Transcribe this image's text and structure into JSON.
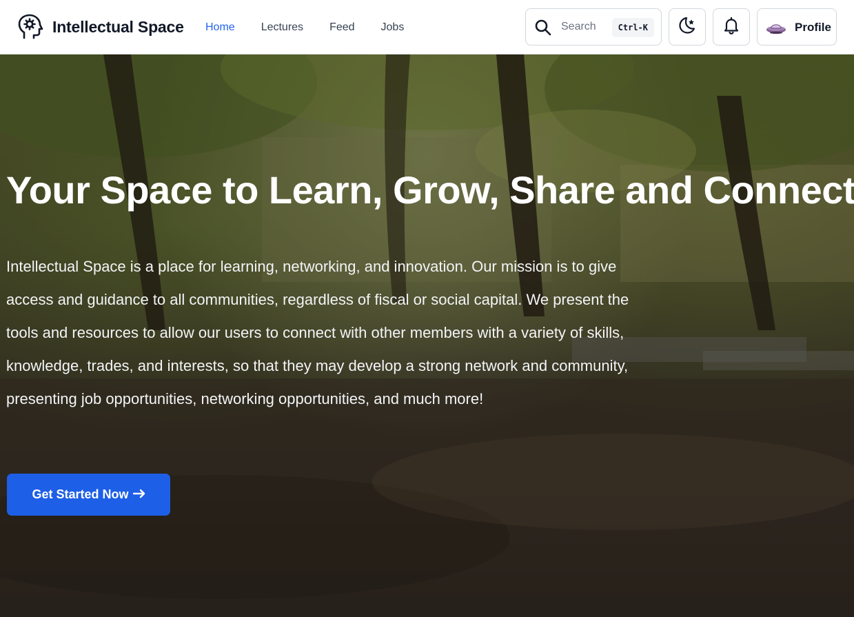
{
  "header": {
    "brand": {
      "name": "Intellectual Space",
      "logo_icon": "head-gear-icon"
    },
    "nav": [
      {
        "label": "Home",
        "active": true
      },
      {
        "label": "Lectures",
        "active": false
      },
      {
        "label": "Feed",
        "active": false
      },
      {
        "label": "Jobs",
        "active": false
      }
    ],
    "search": {
      "placeholder": "Search",
      "shortcut": "Ctrl-K",
      "icon": "search-icon"
    },
    "theme_toggle_icon": "moon-stars-icon",
    "notifications_icon": "bell-icon",
    "profile": {
      "label": "Profile",
      "avatar_icon": "ufo-avatar"
    }
  },
  "hero": {
    "title": "Your Space to Learn, Grow, Share and Connect",
    "body": "Intellectual Space is a place for learning, networking, and innovation. Our mission is to give access and guidance to all communities, regardless of fiscal or social capital. We present the tools and resources to allow our users to connect with other members with a variety of skills, knowledge, trades, and interests, so that they may develop a strong network and community, presenting job opportunities, networking opportunities, and much more!",
    "cta_label": "Get Started Now",
    "cta_icon": "arrow-right-icon"
  },
  "colors": {
    "accent": "#2563eb",
    "cta": "#1d5fe6",
    "text_dark": "#111827"
  }
}
